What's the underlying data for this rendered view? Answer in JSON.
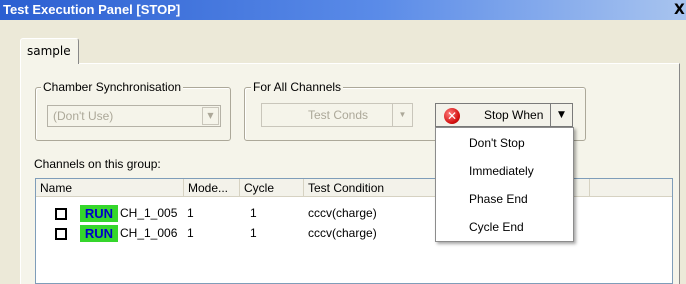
{
  "window": {
    "title": "Test Execution Panel [STOP]",
    "close_label": "X"
  },
  "tabs": [
    {
      "label": "sample"
    }
  ],
  "chamber_sync": {
    "legend": "Chamber Synchronisation",
    "value": "(Don't Use)"
  },
  "all_channels": {
    "legend": "For All Channels",
    "test_conds_label": "Test Conds",
    "stop_when_label": "Stop When",
    "stop_when_menu": [
      "Don't Stop",
      "Immediately",
      "Phase End",
      "Cycle End"
    ]
  },
  "channels": {
    "label": "Channels on this group:",
    "columns": [
      "Name",
      "Mode...",
      "Cycle",
      "Test Condition"
    ],
    "rows": [
      {
        "status": "RUN",
        "name": "CH_1_005",
        "mode": "1",
        "cycle": "1",
        "condition": "cccv(charge)"
      },
      {
        "status": "RUN",
        "name": "CH_1_006",
        "mode": "1",
        "cycle": "1",
        "condition": "cccv(charge)"
      }
    ]
  },
  "icons": {
    "stop": "stop-icon",
    "dropdown": "chevron-down-icon",
    "checkbox": "checkbox-icon"
  },
  "colors": {
    "titlebar": "#2b5fd1",
    "run_badge_bg": "#35d62c",
    "run_badge_text": "#0000c8",
    "stop_icon": "#d31010"
  }
}
